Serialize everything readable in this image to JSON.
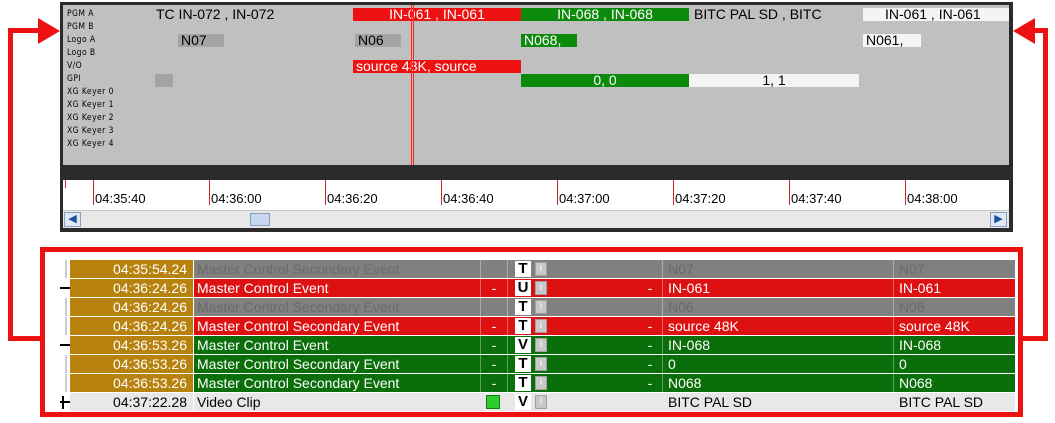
{
  "timeline": {
    "tracks": [
      "PGM A",
      "PGM B",
      "Logo A",
      "Logo B",
      "V/O",
      "GPI",
      "XG Keyer 0",
      "XG Keyer 1",
      "XG Keyer 2",
      "XG Keyer 3",
      "XG Keyer 4"
    ],
    "pgm_a": [
      {
        "text": "TC    IN-072  , IN-072",
        "color": "plain"
      },
      {
        "text": "IN-061  , IN-061",
        "color": "red"
      },
      {
        "text": "IN-068  , IN-068",
        "color": "green"
      },
      {
        "text": "BITC  PAL  SD  , BITC",
        "color": "plain"
      },
      {
        "text": "IN-061  , IN-061",
        "color": "white"
      }
    ],
    "logo_a": [
      {
        "text": "N07",
        "color": "grey"
      },
      {
        "text": "N06",
        "color": "grey"
      },
      {
        "text": "N068,",
        "color": "green"
      },
      {
        "text": "N061,",
        "color": "white"
      }
    ],
    "vo": [
      {
        "text": "source  48K, source",
        "color": "red"
      }
    ],
    "gpi": [
      {
        "text": "",
        "color": "grey"
      },
      {
        "text": "0, 0",
        "color": "green"
      },
      {
        "text": "1, 1",
        "color": "white"
      }
    ],
    "ruler": [
      "04:35:40",
      "04:36:00",
      "04:36:20",
      "04:36:40",
      "04:37:00",
      "04:37:20",
      "04:37:40",
      "04:38:00"
    ]
  },
  "events": [
    {
      "time": "04:35:54.24",
      "name": "Master Control Secondary Event",
      "flag": "",
      "icon": "T",
      "c": "",
      "d": "N07",
      "e": "N07",
      "color": "grey"
    },
    {
      "time": "04:36:24.26",
      "name": "Master Control Event",
      "flag": "-",
      "icon": "U",
      "c": "-",
      "d": "IN-061",
      "e": "IN-061",
      "color": "red"
    },
    {
      "time": "04:36:24.26",
      "name": "Master Control Secondary Event",
      "flag": "",
      "icon": "T",
      "c": "",
      "d": "N06",
      "e": "N06",
      "color": "grey"
    },
    {
      "time": "04:36:24.26",
      "name": "Master Control Secondary Event",
      "flag": "-",
      "icon": "T",
      "c": "-",
      "d": "source  48K",
      "e": "source  48K",
      "color": "red"
    },
    {
      "time": "04:36:53.26",
      "name": "Master Control Event",
      "flag": "-",
      "icon": "V",
      "c": "-",
      "d": "IN-068",
      "e": "IN-068",
      "color": "green"
    },
    {
      "time": "04:36:53.26",
      "name": "Master Control Secondary Event",
      "flag": "-",
      "icon": "T",
      "c": "-",
      "d": "0",
      "e": "0",
      "color": "green"
    },
    {
      "time": "04:36:53.26",
      "name": "Master Control Secondary Event",
      "flag": "-",
      "icon": "T",
      "c": "-",
      "d": "N068",
      "e": "N068",
      "color": "green"
    },
    {
      "time": "04:37:22.28",
      "name": "Video Clip",
      "flag": "",
      "icon": "V",
      "c": "",
      "d": "BITC  PAL  SD",
      "e": "BITC  PAL  SD",
      "color": "white"
    }
  ],
  "colors": {
    "accent": "#ee1111",
    "green": "#0a6e0a",
    "time_cell": "#b8820e"
  }
}
